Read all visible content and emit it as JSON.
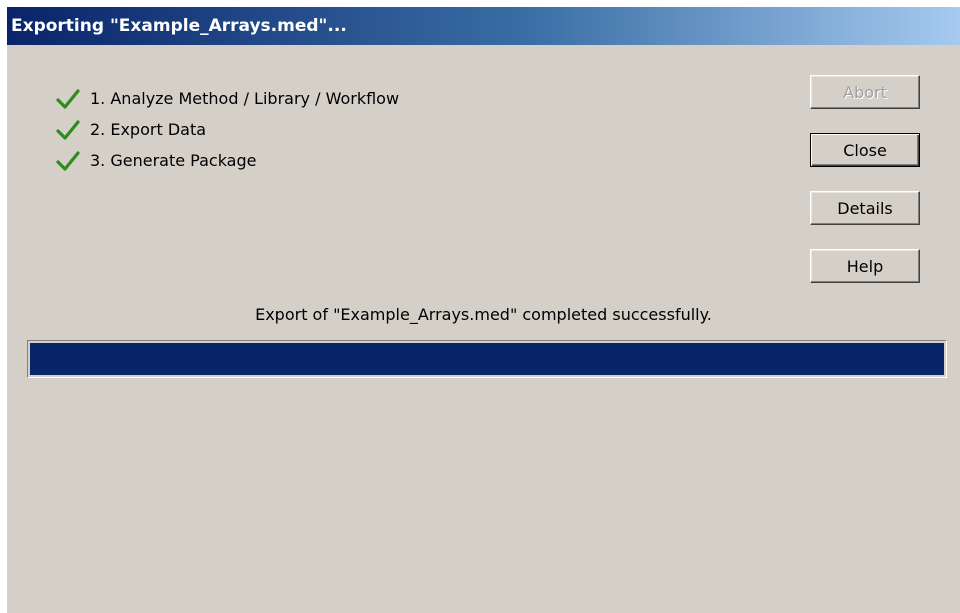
{
  "window": {
    "title": "Exporting \"Example_Arrays.med\"..."
  },
  "steps": [
    {
      "label": "1. Analyze Method / Library / Workflow",
      "status": "done",
      "icon": "checkmark-icon"
    },
    {
      "label": "2. Export Data",
      "status": "done",
      "icon": "checkmark-icon"
    },
    {
      "label": "3. Generate Package",
      "status": "done",
      "icon": "checkmark-icon"
    }
  ],
  "buttons": {
    "abort": {
      "label": "Abort",
      "enabled": false
    },
    "close": {
      "label": "Close",
      "enabled": true,
      "default": true
    },
    "details": {
      "label": "Details",
      "enabled": true
    },
    "help": {
      "label": "Help",
      "enabled": true
    }
  },
  "status_message": "Export of \"Example_Arrays.med\" completed successfully.",
  "progress": {
    "percent": 100
  },
  "colors": {
    "check": "#2e8b1e",
    "progress_fill": "#0a246a",
    "dialog_bg": "#d4d0c8"
  }
}
